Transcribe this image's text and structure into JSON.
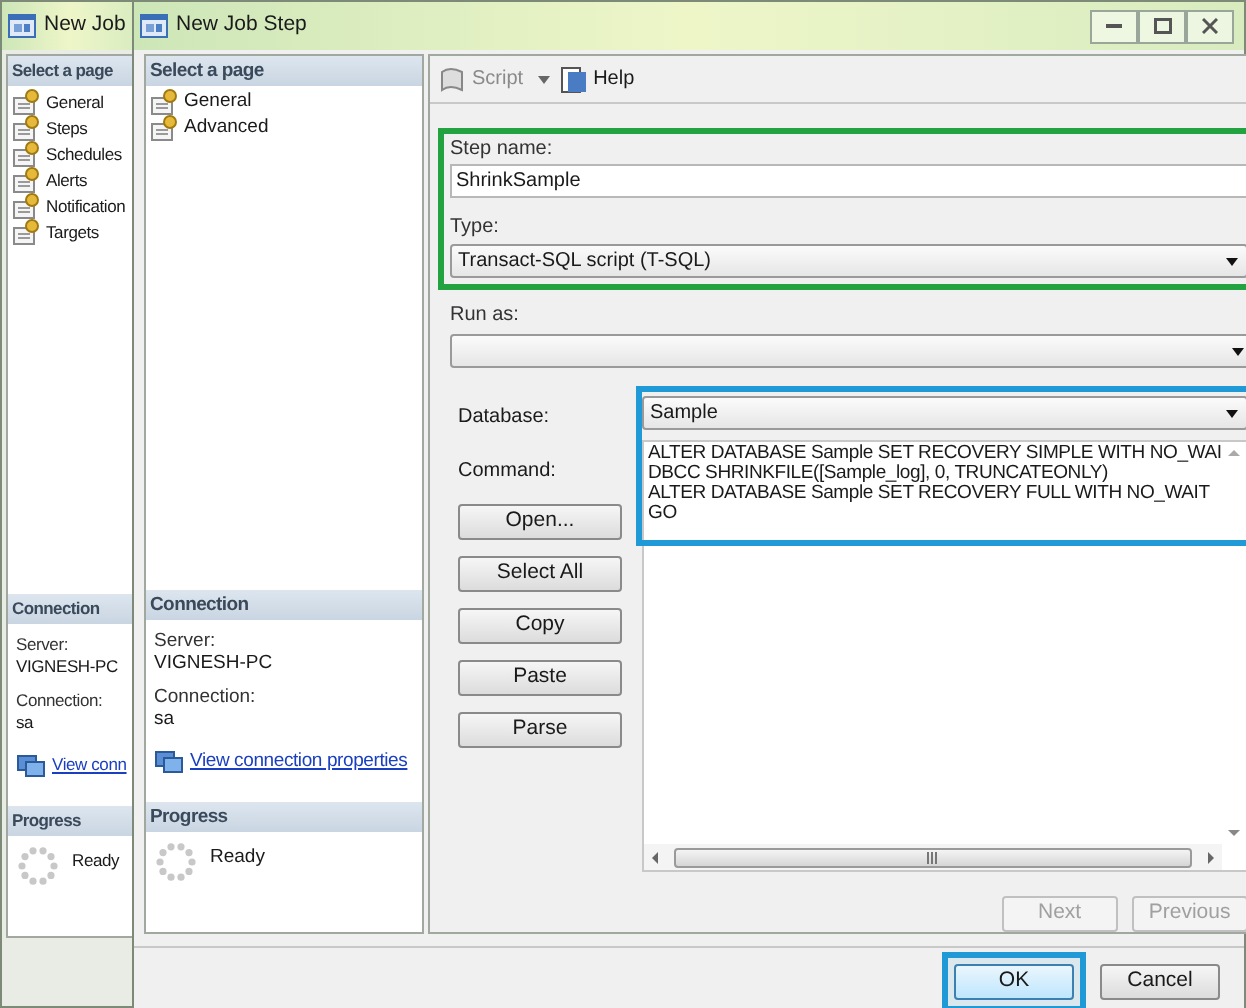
{
  "back_window": {
    "title": "New Job",
    "select_page_header": "Select a page",
    "pages": [
      {
        "label": "General"
      },
      {
        "label": "Steps"
      },
      {
        "label": "Schedules"
      },
      {
        "label": "Alerts"
      },
      {
        "label": "Notification"
      },
      {
        "label": "Targets"
      }
    ],
    "connection_header": "Connection",
    "server_label": "Server:",
    "server": "VIGNESH-PC",
    "connection_label": "Connection:",
    "connection": "sa",
    "link": "View conn",
    "progress_header": "Progress",
    "status": "Ready"
  },
  "window": {
    "title": "New Job Step",
    "select_page_header": "Select a page",
    "pages": [
      {
        "label": "General"
      },
      {
        "label": "Advanced"
      }
    ],
    "connection_header": "Connection",
    "server_label": "Server:",
    "server": "VIGNESH-PC",
    "connection_label": "Connection:",
    "connection": "sa",
    "link": "View connection properties",
    "progress_header": "Progress",
    "status": "Ready"
  },
  "toolbar": [
    {
      "label": "Script",
      "kind": "dropdown"
    },
    {
      "label": "Help",
      "kind": "button"
    }
  ],
  "step_name": {
    "label": "Step name:",
    "value": "ShrinkSample"
  },
  "type": {
    "label": "Type:",
    "value": "Transact-SQL script (T-SQL)"
  },
  "run_as": {
    "label": "Run as:"
  },
  "database": {
    "label": "Database:",
    "value": "Sample"
  },
  "command": {
    "label": "Command:",
    "lines": [
      "ALTER DATABASE Sample SET RECOVERY SIMPLE WITH NO_WAI",
      "DBCC SHRINKFILE([Sample_log], 0, TRUNCATEONLY)",
      "ALTER DATABASE Sample SET RECOVERY FULL WITH NO_WAIT",
      "GO"
    ]
  },
  "command_buttons": [
    "Open...",
    "Select All",
    "Copy",
    "Paste",
    "Parse"
  ],
  "nav_buttons": [
    {
      "label": "Next",
      "disabled": true
    },
    {
      "label": "Previous",
      "disabled": true
    }
  ],
  "dialog_buttons": [
    "OK",
    "Cancel"
  ]
}
